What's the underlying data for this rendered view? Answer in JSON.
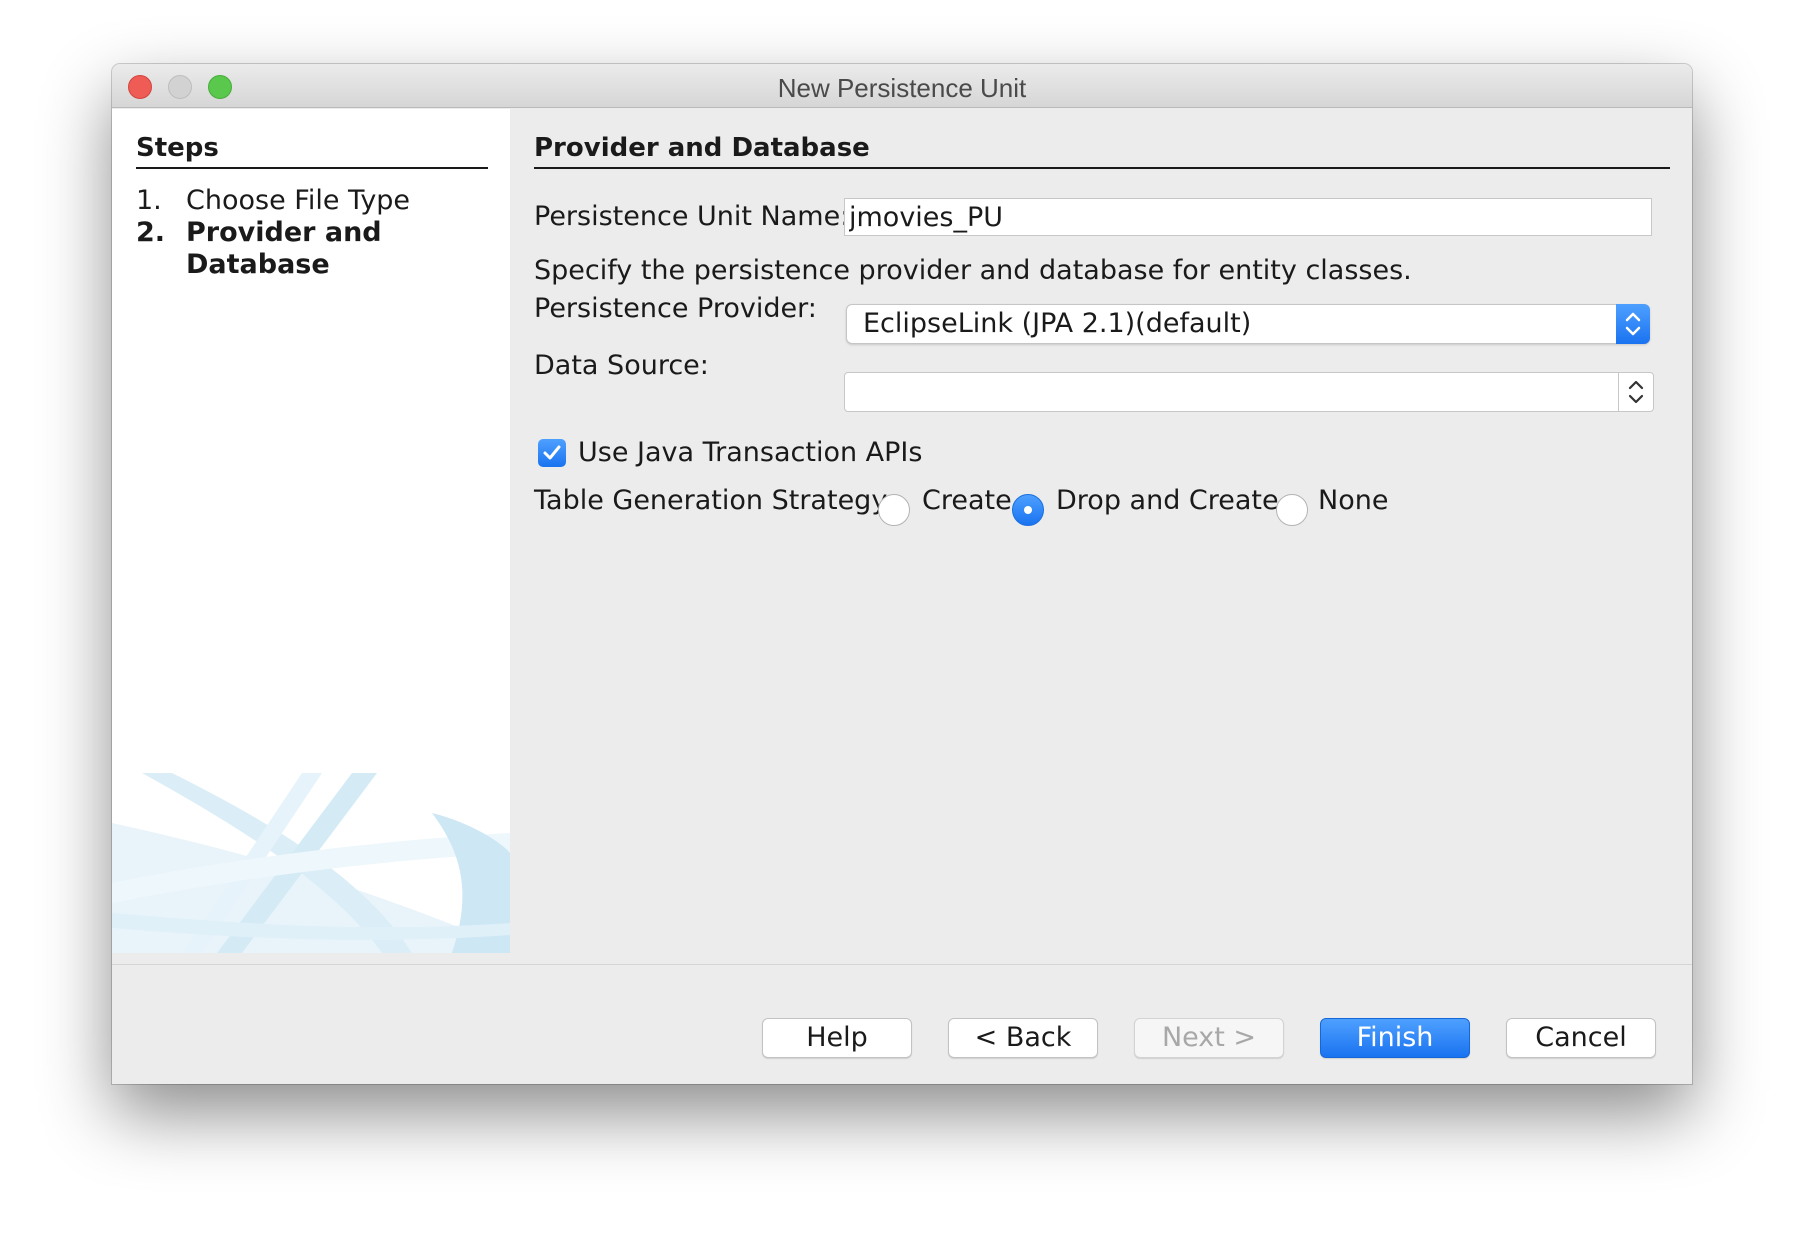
{
  "window": {
    "title": "New Persistence Unit"
  },
  "steps": {
    "heading": "Steps",
    "items": [
      {
        "number": "1.",
        "label": "Choose File Type",
        "current": false
      },
      {
        "number": "2.",
        "label": "Provider and Database",
        "current": true
      }
    ]
  },
  "section": {
    "title": "Provider and Database"
  },
  "form": {
    "unit_name_label": "Persistence Unit Name:",
    "unit_name_value": "jmovies_PU",
    "description": "Specify the persistence provider and database for entity classes.",
    "provider_label": "Persistence Provider:",
    "provider_value": "EclipseLink (JPA 2.1)(default)",
    "data_source_label": "Data Source:",
    "data_source_value": "",
    "jta_label": "Use Java Transaction APIs",
    "jta_checked": true,
    "strategy_label": "Table Generation Strategy:",
    "strategy_options": [
      "Create",
      "Drop and Create",
      "None"
    ],
    "strategy_selected": "Drop and Create"
  },
  "buttons": {
    "help": "Help",
    "back": "< Back",
    "next": "Next >",
    "finish": "Finish",
    "cancel": "Cancel"
  },
  "colors": {
    "accent": "#1a73f0",
    "window_bg": "#ececec",
    "close": "#ee5c55",
    "zoom": "#5ac84c"
  }
}
